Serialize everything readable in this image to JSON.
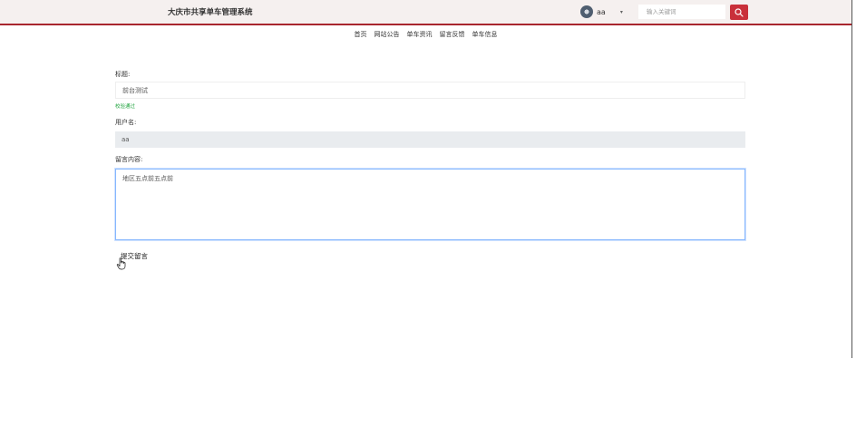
{
  "app": {
    "title": "大庆市共享单车管理系统"
  },
  "user": {
    "name": "aa",
    "caret": "▾"
  },
  "search": {
    "placeholder": "输入关键词"
  },
  "nav": {
    "items": [
      {
        "label": "首页"
      },
      {
        "label": "网站公告"
      },
      {
        "label": "单车资讯"
      },
      {
        "label": "留言反馈"
      },
      {
        "label": "单车信息"
      }
    ]
  },
  "form": {
    "title_label": "标题:",
    "title_value": "前台测试",
    "validation_text": "校验通过",
    "username_label": "用户名:",
    "username_value": "aa",
    "content_label": "留言内容:",
    "content_value": "地区五点前五点前",
    "submit_label": "提交留言"
  },
  "colors": {
    "topbar_bg": "#f5f0ef",
    "accent": "#c9303a",
    "validation": "#28a745"
  },
  "icons": {
    "avatar": "avatar-icon",
    "search": "search-icon",
    "cursor": "hand-pointer-icon"
  }
}
